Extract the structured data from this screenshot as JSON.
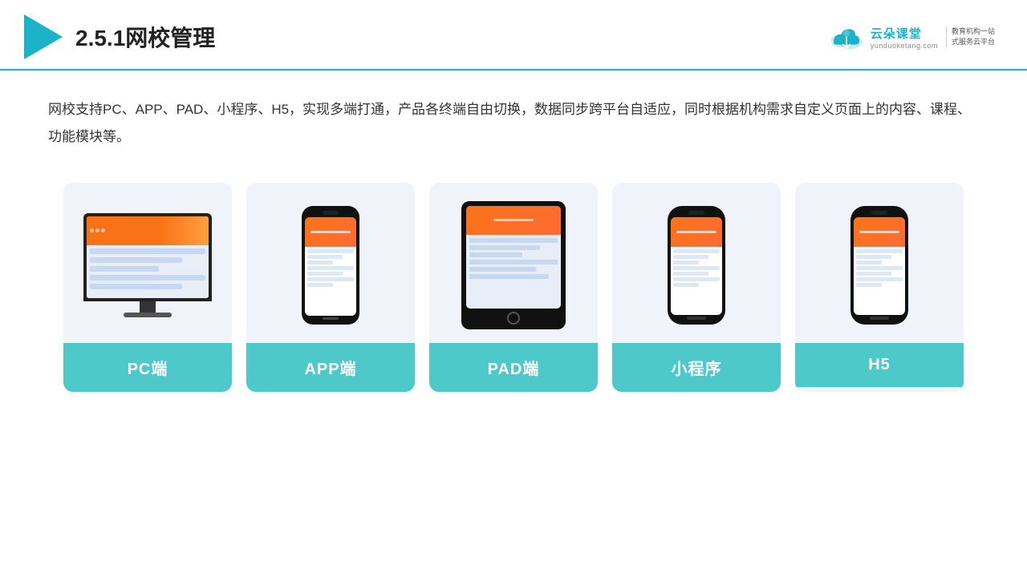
{
  "header": {
    "title": "2.5.1网校管理",
    "brand": {
      "name": "云朵课堂",
      "url": "yunduoketang.com",
      "slogan_line1": "教育机构一站",
      "slogan_line2": "式服务云平台"
    }
  },
  "description": {
    "text": "网校支持PC、APP、PAD、小程序、H5，实现多端打通，产品各终端自由切换，数据同步跨平台自适应，同时根据机构需求自定义页面上的内容、课程、功能模块等。"
  },
  "cards": [
    {
      "id": "pc",
      "label": "PC端"
    },
    {
      "id": "app",
      "label": "APP端"
    },
    {
      "id": "pad",
      "label": "PAD端"
    },
    {
      "id": "miniapp",
      "label": "小程序"
    },
    {
      "id": "h5",
      "label": "H5"
    }
  ],
  "colors": {
    "teal": "#4dc9c9",
    "teal_dark": "#1ab3c8",
    "orange": "#f97316",
    "bg_card": "#f0f4fa"
  }
}
